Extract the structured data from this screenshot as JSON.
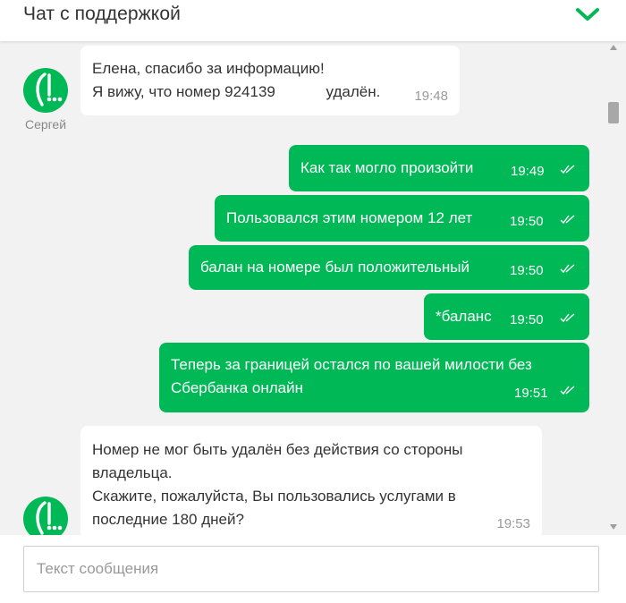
{
  "header": {
    "title": "Чат с поддержкой",
    "toggle_icon": "chevron-down-icon"
  },
  "colors": {
    "accent": "#00b956",
    "chat_bg": "#f2f2f2",
    "incoming_bg": "#ffffff"
  },
  "agent": {
    "name": "Сергей",
    "avatar_icon": "megafon-logo-icon"
  },
  "messages": [
    {
      "direction": "in",
      "lines": [
        "Елена, спасибо за информацию!",
        "Я вижу, что номер 924139            удалён."
      ],
      "time": "19:48"
    },
    {
      "direction": "out",
      "lines": [
        "Как так могло произойти"
      ],
      "time": "19:49",
      "status_icon": "double-check-icon"
    },
    {
      "direction": "out",
      "lines": [
        "Пользовался этим номером 12 лет"
      ],
      "time": "19:50",
      "status_icon": "double-check-icon"
    },
    {
      "direction": "out",
      "lines": [
        "балан на номере был положительный"
      ],
      "time": "19:50",
      "status_icon": "double-check-icon"
    },
    {
      "direction": "out",
      "lines": [
        "*баланс"
      ],
      "time": "19:50",
      "status_icon": "double-check-icon"
    },
    {
      "direction": "out",
      "lines": [
        "Теперь за границей остался по вашей милости без",
        "Сбербанка онлайн"
      ],
      "time": "19:51",
      "status_icon": "double-check-icon"
    },
    {
      "direction": "in",
      "lines": [
        "Номер не мог быть удалён без действия со стороны",
        "владельца.",
        "Скажите, пожалуйста, Вы пользовались услугами в",
        "последние 180 дней?"
      ],
      "time": "19:53"
    }
  ],
  "composer": {
    "placeholder": "Текст сообщения",
    "value": ""
  }
}
